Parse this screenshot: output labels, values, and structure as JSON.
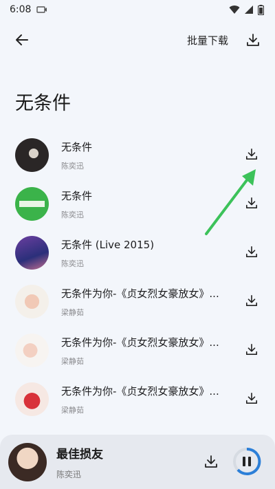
{
  "status": {
    "time": "6:08"
  },
  "topbar": {
    "batch_download": "批量下载"
  },
  "page_title": "无条件",
  "songs": [
    {
      "title": "无条件",
      "artist": "陈奕迅"
    },
    {
      "title": "无条件",
      "artist": "陈奕迅"
    },
    {
      "title": "无条件 (Live 2015)",
      "artist": "陈奕迅"
    },
    {
      "title": "无条件为你-《贞女烈女豪放女》...",
      "artist": "梁静茹"
    },
    {
      "title": "无条件为你-《贞女烈女豪放女》...",
      "artist": "梁静茹"
    },
    {
      "title": "无条件为你-《贞女烈女豪放女》...",
      "artist": "梁静茹"
    }
  ],
  "player": {
    "title": "最佳损友",
    "artist": "陈奕迅",
    "state": "playing"
  },
  "accent": "#3cc25a",
  "icons": [
    "back-arrow-icon",
    "download-icon",
    "pause-icon",
    "wifi-icon",
    "signal-icon",
    "battery-icon"
  ]
}
